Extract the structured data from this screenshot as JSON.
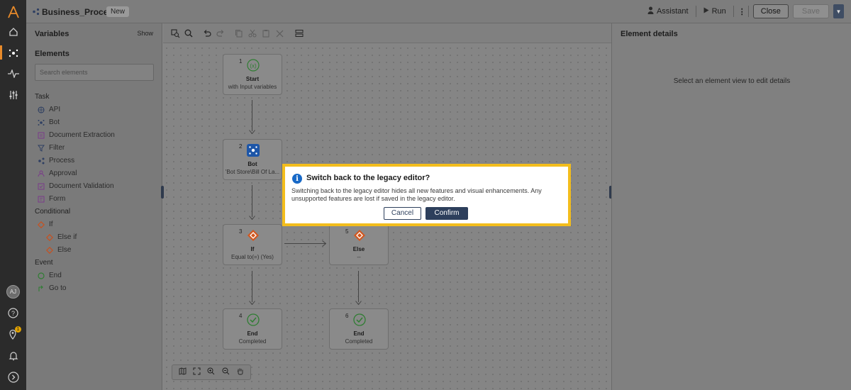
{
  "app": {
    "title": "Business_Process",
    "tag": "New",
    "accent": "#e88a2a"
  },
  "rail": {
    "avatar_initials": "AJ",
    "notification_count": "1"
  },
  "toolbar": {
    "assistant_label": "Assistant",
    "run_label": "Run",
    "close_label": "Close",
    "save_label": "Save"
  },
  "left_panel": {
    "variables_label": "Variables",
    "show_label": "Show",
    "elements_label": "Elements",
    "search_placeholder": "Search elements",
    "sections": [
      {
        "label": "Task",
        "items": [
          "API",
          "Bot",
          "Document Extraction",
          "Filter",
          "Process",
          "Approval",
          "Document Validation",
          "Form"
        ]
      },
      {
        "label": "Conditional",
        "items": [
          "If",
          "Else if",
          "Else"
        ]
      },
      {
        "label": "Event",
        "items": [
          "End",
          "Go to"
        ]
      }
    ]
  },
  "flow": {
    "nodes": [
      {
        "num": "1",
        "title": "Start",
        "sub": "with Input variables"
      },
      {
        "num": "2",
        "title": "Bot",
        "sub": "'Bot Store\\Bill Of La..."
      },
      {
        "num": "3",
        "title": "If",
        "sub": "Equal to(=) (Yes)"
      },
      {
        "num": "5",
        "title": "Else",
        "sub": "--"
      },
      {
        "num": "4",
        "title": "End",
        "sub": "Completed"
      },
      {
        "num": "6",
        "title": "End",
        "sub": "Completed"
      }
    ]
  },
  "right_panel": {
    "title": "Element details",
    "hint": "Select an element view to edit details"
  },
  "dialog": {
    "title": "Switch back to the legacy editor?",
    "message": "Switching back to the legacy editor hides all new features and visual enhancements. Any unsupported features are lost if saved in the legacy editor.",
    "cancel_label": "Cancel",
    "confirm_label": "Confirm",
    "border_color": "#f3bd1c",
    "primary_color": "#2d3f5c"
  }
}
